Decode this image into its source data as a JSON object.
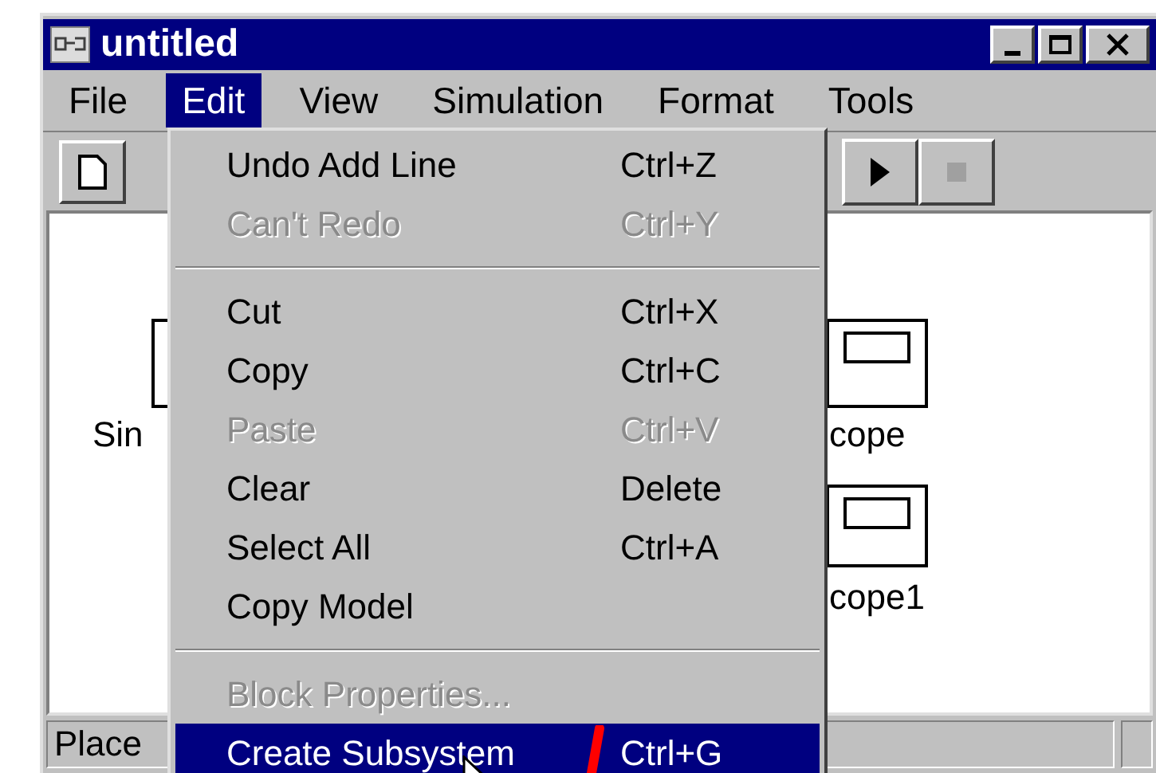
{
  "window": {
    "title": "untitled"
  },
  "menu_bar": [
    {
      "label": "File",
      "selected": false
    },
    {
      "label": "Edit",
      "selected": true
    },
    {
      "label": "View",
      "selected": false
    },
    {
      "label": "Simulation",
      "selected": false
    },
    {
      "label": "Format",
      "selected": false
    },
    {
      "label": "Tools",
      "selected": false
    }
  ],
  "canvas": {
    "blocks": [
      {
        "label": "Sin",
        "kind": "source"
      },
      {
        "label": "cope",
        "kind": "scope"
      },
      {
        "label": "cope1",
        "kind": "scope"
      }
    ]
  },
  "edit_menu": {
    "items": [
      {
        "kind": "item",
        "label": "Undo Add Line",
        "shortcut": "Ctrl+Z",
        "disabled": false,
        "selected": false
      },
      {
        "kind": "item",
        "label": "Can't Redo",
        "shortcut": "Ctrl+Y",
        "disabled": true,
        "selected": false
      },
      {
        "kind": "separator"
      },
      {
        "kind": "item",
        "label": "Cut",
        "shortcut": "Ctrl+X",
        "disabled": false,
        "selected": false
      },
      {
        "kind": "item",
        "label": "Copy",
        "shortcut": "Ctrl+C",
        "disabled": false,
        "selected": false
      },
      {
        "kind": "item",
        "label": "Paste",
        "shortcut": "Ctrl+V",
        "disabled": true,
        "selected": false
      },
      {
        "kind": "item",
        "label": "Clear",
        "shortcut": "Delete",
        "disabled": false,
        "selected": false
      },
      {
        "kind": "item",
        "label": "Select All",
        "shortcut": "Ctrl+A",
        "disabled": false,
        "selected": false
      },
      {
        "kind": "item",
        "label": "Copy Model",
        "disabled": false,
        "selected": false
      },
      {
        "kind": "separator"
      },
      {
        "kind": "item",
        "label": "Block Properties...",
        "disabled": true,
        "selected": false
      },
      {
        "kind": "item",
        "label": "Create Subsystem",
        "shortcut": "Ctrl+G",
        "disabled": false,
        "selected": true
      }
    ]
  },
  "status_bar": {
    "text": "Place"
  }
}
